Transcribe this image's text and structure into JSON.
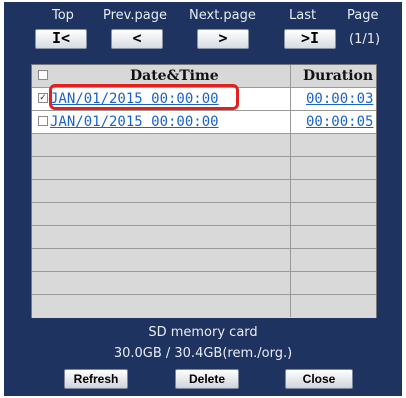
{
  "nav": {
    "labels": {
      "top": "Top",
      "prev": "Prev.page",
      "next": "Next.page",
      "last": "Last",
      "page": "Page"
    },
    "buttons": {
      "top": "I<",
      "prev": "<",
      "next": ">",
      "last": ">I"
    },
    "page_info": "(1/1)"
  },
  "table": {
    "headers": {
      "datetime": "Date&Time",
      "duration": "Duration"
    },
    "rows": [
      {
        "checked": true,
        "datetime": "JAN/01/2015 00:00:00",
        "duration": "00:00:03"
      },
      {
        "checked": false,
        "datetime": "JAN/01/2015 00:00:00",
        "duration": "00:00:05"
      }
    ]
  },
  "sd": {
    "title": "SD memory card",
    "capacity": "30.0GB / 30.4GB(rem./org.)"
  },
  "actions": {
    "refresh": "Refresh",
    "delete": "Delete",
    "close": "Close"
  },
  "colors": {
    "panel_bg": "#1f3361",
    "link": "#1b62c8",
    "highlight": "#e32020"
  }
}
